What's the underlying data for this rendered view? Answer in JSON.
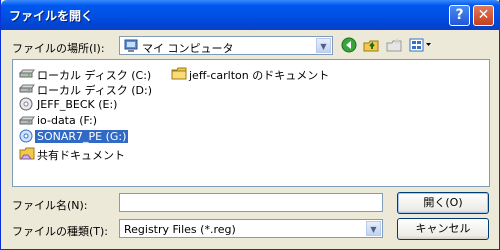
{
  "window": {
    "title": "ファイルを開く",
    "help_label": "?",
    "close_label": "✕"
  },
  "look_in": {
    "label": "ファイルの場所(I):",
    "value": "マイ コンピュータ",
    "icon": "my-computer-icon"
  },
  "toolbar": {
    "back_icon": "back-icon",
    "up_icon": "up-folder-icon",
    "new_folder_icon": "new-folder-icon",
    "views_icon": "views-menu-icon"
  },
  "files": [
    {
      "name": "ローカル ディスク (C:)",
      "icon": "local-disk-icon"
    },
    {
      "name": "ローカル ディスク (D:)",
      "icon": "local-disk-icon"
    },
    {
      "name": "JEFF_BECK (E:)",
      "icon": "cd-drive-icon"
    },
    {
      "name": "io-data (F:)",
      "icon": "local-disk-icon"
    },
    {
      "name": "SONAR7_PE (G:)",
      "icon": "cd-drive-icon",
      "selected": true
    },
    {
      "name": "共有ドキュメント",
      "icon": "shared-folder-icon"
    },
    {
      "name": "jeff-carlton のドキュメント",
      "icon": "folder-icon"
    }
  ],
  "filename": {
    "label": "ファイル名(N):",
    "value": ""
  },
  "filetype": {
    "label": "ファイルの種類(T):",
    "value": "Registry Files (*.reg)"
  },
  "buttons": {
    "open": "開く(O)",
    "cancel": "キャンセル"
  },
  "colors": {
    "titlebar": "#0058ee",
    "selection": "#316ac5",
    "dialog_bg": "#ece9d8"
  }
}
